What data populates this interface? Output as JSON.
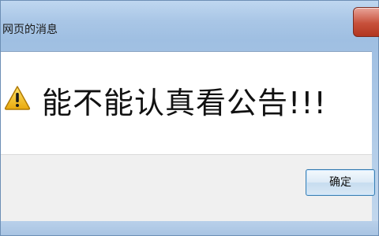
{
  "window": {
    "title": "网页的消息"
  },
  "message": {
    "text": "能不能认真看公告!!!"
  },
  "buttons": {
    "ok_label": "确定"
  },
  "icons": {
    "warning": "warning-icon",
    "close": "close-icon"
  },
  "colors": {
    "close_button": "#c7503b",
    "warning_fill": "#f3c21b",
    "button_border": "#3c7fb1"
  }
}
